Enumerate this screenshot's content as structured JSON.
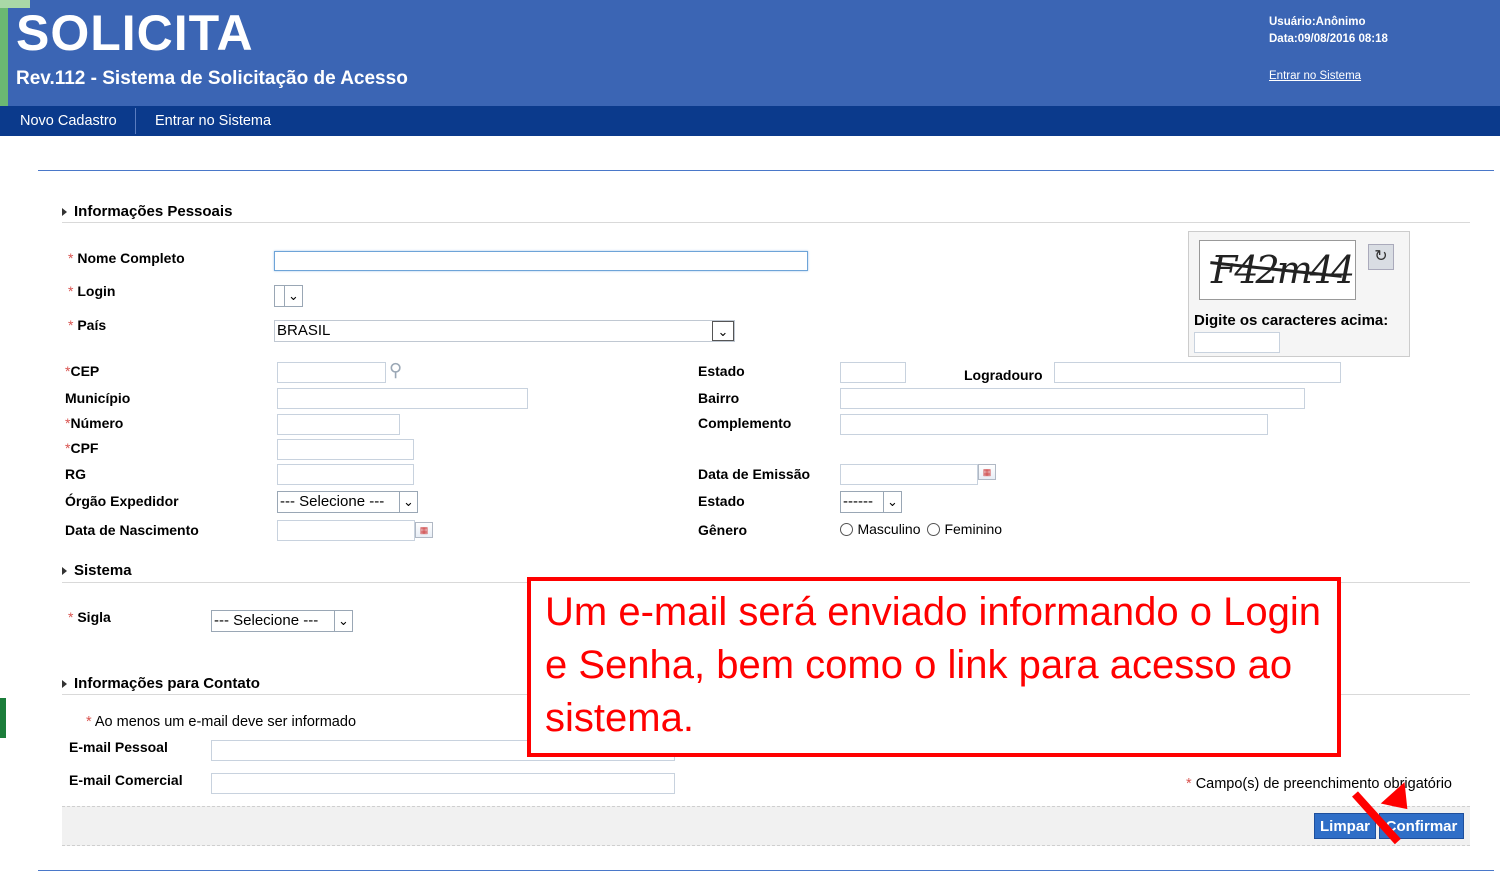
{
  "header": {
    "app_title": "SOLICITA",
    "app_subtitle": "Rev.112 - Sistema de Solicitação de Acesso",
    "user_label": "Usuário:",
    "user_value": "Anônimo",
    "date_label": "Data:",
    "date_value": "09/08/2016 08:18",
    "login_link": "Entrar no Sistema"
  },
  "navbar": {
    "items": [
      {
        "label": "Novo Cadastro"
      },
      {
        "label": "Entrar no Sistema"
      }
    ]
  },
  "personal": {
    "section_title": "Informações Pessoais",
    "nome_label": "Nome Completo",
    "nome_value": "",
    "login_label": "Login",
    "pais_label": "País",
    "pais_value": "BRASIL",
    "cep_label": "CEP",
    "estado_label": "Estado",
    "logradouro_label": "Logradouro",
    "municipio_label": "Município",
    "bairro_label": "Bairro",
    "numero_label": "Número",
    "complemento_label": "Complemento",
    "cpf_label": "CPF",
    "rg_label": "RG",
    "data_emissao_label": "Data de Emissão",
    "orgao_label": "Órgão Expedidor",
    "orgao_value": "--- Selecione ---",
    "estado2_label": "Estado",
    "estado2_value": "------",
    "nascimento_label": "Data de Nascimento",
    "genero_label": "Gênero",
    "genero_options": [
      "Masculino",
      "Feminino"
    ],
    "required_marker": "*"
  },
  "captcha": {
    "image_text": "F42m44",
    "prompt": "Digite os caracteres acima:",
    "refresh_icon": "refresh-icon"
  },
  "system": {
    "section_title": "Sistema",
    "sigla_label": "Sigla",
    "sigla_value": "--- Selecione ---"
  },
  "contact": {
    "section_title": "Informações para Contato",
    "note": "Ao menos um e-mail deve ser informado",
    "email_pessoal_label": "E-mail Pessoal",
    "email_comercial_label": "E-mail Comercial",
    "required_note": "Campo(s) de preenchimento obrigatório"
  },
  "actions": {
    "clear_label": "Limpar",
    "confirm_label": "Confirmar"
  },
  "callout": {
    "text": "Um e-mail será enviado informando o Login e Senha, bem como o link para acesso ao sistema.",
    "color": "#ff0000"
  },
  "colors": {
    "header_bg": "#3b65b4",
    "navbar_bg": "#0b3a8c",
    "button_bg": "#2f6ec7"
  }
}
